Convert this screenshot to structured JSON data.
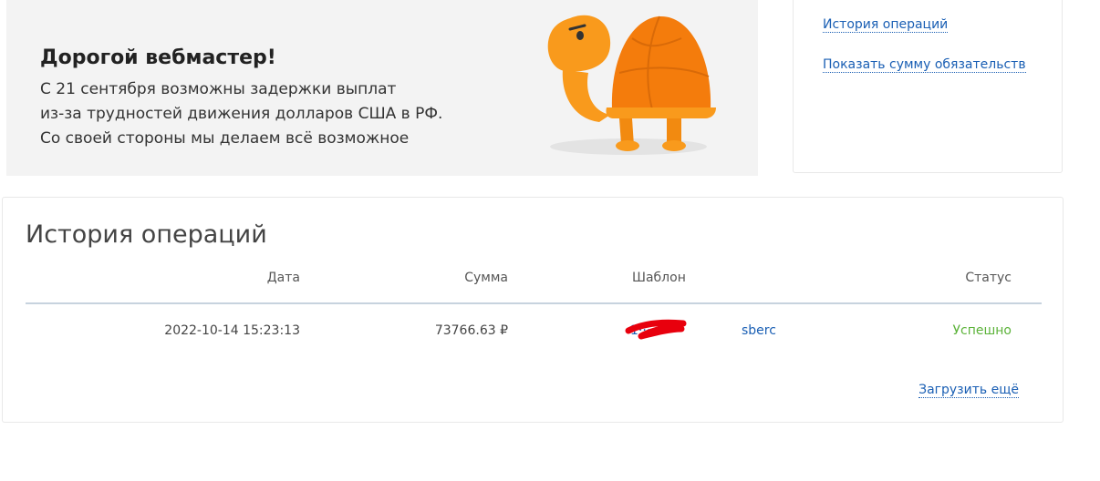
{
  "banner": {
    "title": "Дорогой вебмастер!",
    "lines": [
      "С 21 сентября возможны задержки выплат",
      "из-за трудностей движения долларов США в РФ.",
      "Со своей стороны мы делаем всё возможное"
    ]
  },
  "sidebar": {
    "links": [
      "История операций",
      "Показать сумму обязательств"
    ]
  },
  "history": {
    "title": "История операций",
    "columns": {
      "date": "Дата",
      "sum": "Сумма",
      "template": "Шаблон",
      "status": "Статус"
    },
    "rows": [
      {
        "date": "2022-10-14 15:23:13",
        "sum": "73766.63 ₽",
        "template_id": "1····2",
        "template_name": "sberc",
        "status": "Успешно"
      }
    ],
    "load_more": "Загрузить ещё"
  },
  "colors": {
    "link": "#1a5fb4",
    "success": "#5cb33a",
    "banner_bg": "#f3f3f3",
    "turtle_body": "#f99a1c",
    "turtle_shell": "#f47c0c",
    "redaction": "#e8000d"
  },
  "icons": {
    "mascot": "turtle-mascot",
    "redaction": "red-scribble"
  }
}
